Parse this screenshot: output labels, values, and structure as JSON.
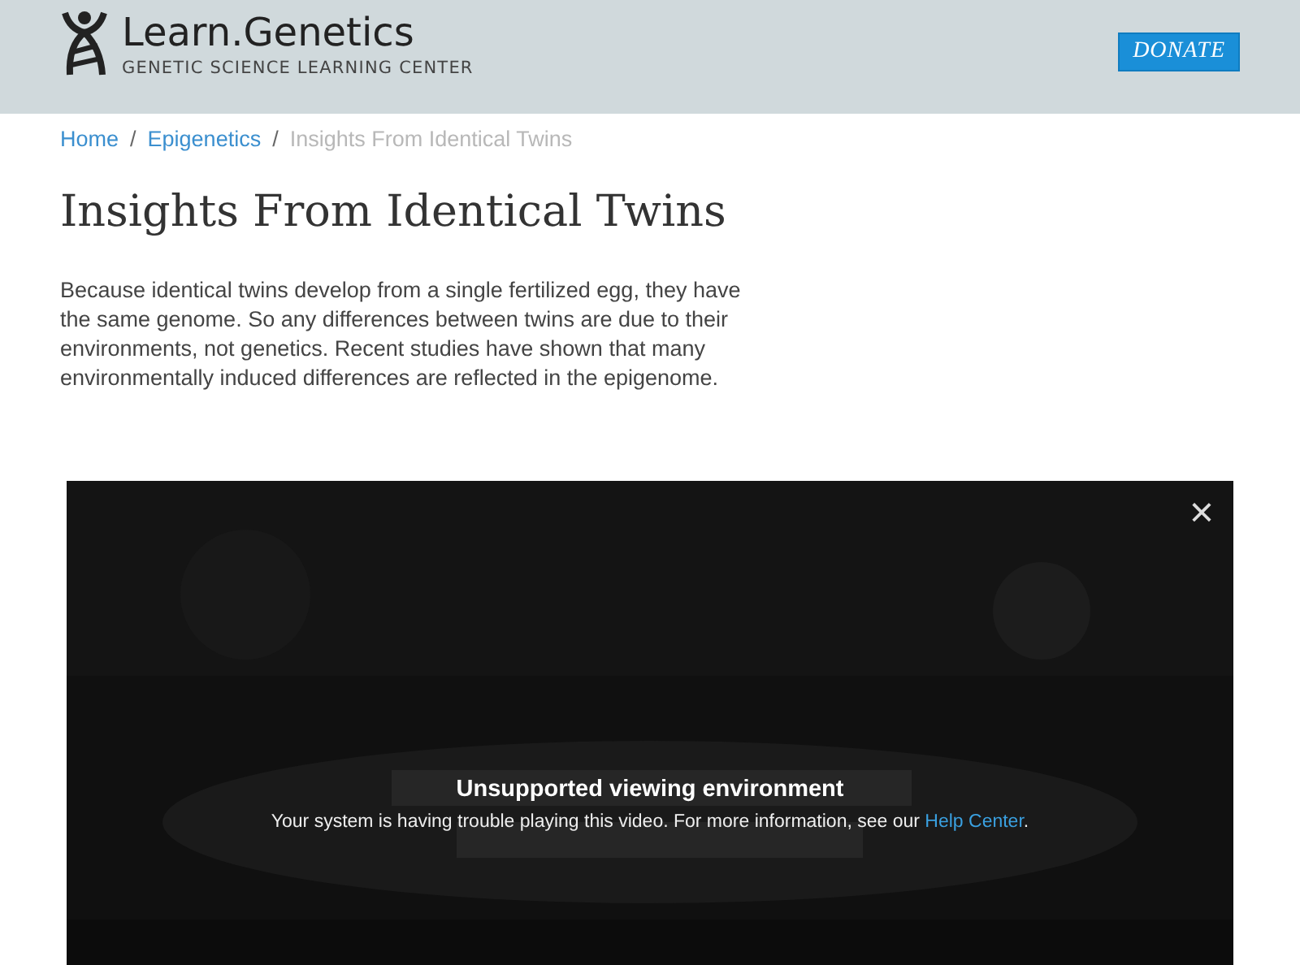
{
  "header": {
    "logo_title": "Learn.Genetics",
    "logo_subtitle": "GENETIC SCIENCE LEARNING CENTER",
    "donate_button": "DONATE"
  },
  "breadcrumb": {
    "links": [
      "Home",
      "Epigenetics"
    ],
    "separator": "/",
    "current": "Insights From Identical Twins"
  },
  "title": "Insights From Identical Twins",
  "intro": "Because identical twins develop from a single fertilized egg, they have the same genome. So any differences between twins are due to their environments, not genetics. Recent studies have shown that many environmentally induced differences are reflected in the epigenome.",
  "video": {
    "kind": "picture",
    "close": "×",
    "error_title": "Unsupported viewing environment",
    "error_text": "Your system is having trouble playing this video. For more information, see our ",
    "error_link": "Help Center",
    "error_end": "."
  }
}
